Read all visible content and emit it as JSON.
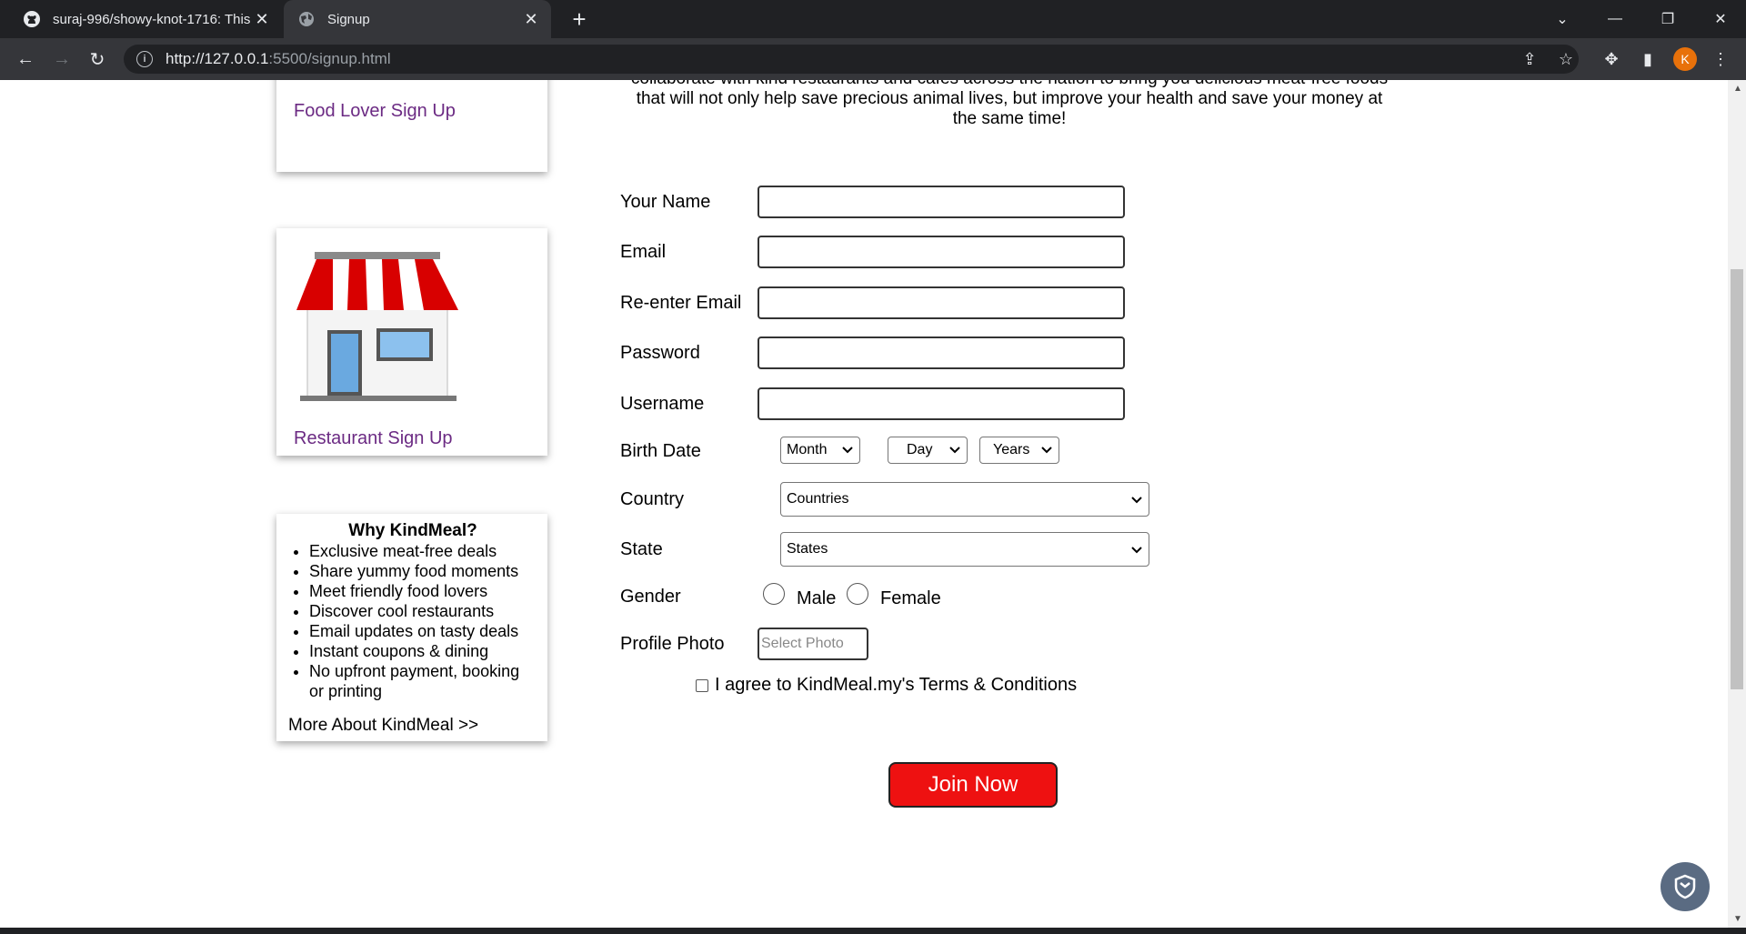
{
  "browser": {
    "tabs": [
      {
        "title": "suraj-996/showy-knot-1716: This",
        "icon": "github-icon"
      },
      {
        "title": "Signup",
        "icon": "globe-icon"
      }
    ],
    "url_host": "http://127.0.0.1",
    "url_rest": ":5500/signup.html",
    "profile_initial": "K"
  },
  "sidebar": {
    "food_lover_link": "Food Lover Sign Up",
    "restaurant_link": "Restaurant Sign Up",
    "why": {
      "title": "Why KindMeal?",
      "items": [
        "Exclusive meat-free deals",
        "Share yummy food moments",
        "Meet friendly food lovers",
        "Discover cool restaurants",
        "Email updates on tasty deals",
        "Instant coupons & dining",
        "No upfront payment, booking or printing"
      ],
      "more": "More About KindMeal >>"
    }
  },
  "intro": {
    "line1": "collaborate with kind restaurants and cafes across the nation to bring you delicious meat-free foods",
    "line2": "that will not only help save precious animal lives, but improve your health and save your money at",
    "line3": "the same time!"
  },
  "form": {
    "labels": {
      "name": "Your Name",
      "email": "Email",
      "reemail": "Re-enter Email",
      "password": "Password",
      "username": "Username",
      "birth": "Birth Date",
      "country": "Country",
      "state": "State",
      "gender": "Gender",
      "photo": "Profile Photo"
    },
    "birth_month": "Month",
    "birth_day": "Day",
    "birth_year": "Years",
    "country_selected": "Countries",
    "state_selected": "States",
    "gender_male": "Male",
    "gender_female": "Female",
    "photo_placeholder": "Select Photo",
    "terms": "I agree to KindMeal.my's Terms & Conditions",
    "submit": "Join Now"
  },
  "colors": {
    "link_purple": "#6b2a83",
    "join_red": "#ee1111"
  }
}
